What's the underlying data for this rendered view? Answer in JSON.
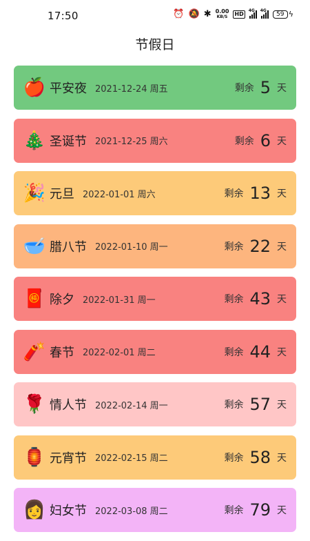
{
  "status_bar": {
    "time": "17:50",
    "net_speed_value": "0.00",
    "net_speed_unit": "KB/S",
    "hd_label": "HD",
    "signal1_label": "4G",
    "signal2_label": "4G",
    "battery": "59"
  },
  "header": {
    "title": "节假日"
  },
  "holidays": [
    {
      "emoji": "🍎",
      "name": "平安夜",
      "date": "2021-12-24 周五",
      "remain_label": "剩余",
      "days": "5",
      "unit": "天",
      "color": "#72c97f"
    },
    {
      "emoji": "🎄",
      "name": "圣诞节",
      "date": "2021-12-25 周六",
      "remain_label": "剩余",
      "days": "6",
      "unit": "天",
      "color": "#f98280"
    },
    {
      "emoji": "🎉",
      "name": "元旦",
      "date": "2022-01-01 周六",
      "remain_label": "剩余",
      "days": "13",
      "unit": "天",
      "color": "#fdca79"
    },
    {
      "emoji": "🥣",
      "name": "腊八节",
      "date": "2022-01-10 周一",
      "remain_label": "剩余",
      "days": "22",
      "unit": "天",
      "color": "#fdb57e"
    },
    {
      "emoji": "🧧",
      "name": "除夕",
      "date": "2022-01-31 周一",
      "remain_label": "剩余",
      "days": "43",
      "unit": "天",
      "color": "#f98280"
    },
    {
      "emoji": "🧨",
      "name": "春节",
      "date": "2022-02-01 周二",
      "remain_label": "剩余",
      "days": "44",
      "unit": "天",
      "color": "#f98280"
    },
    {
      "emoji": "🌹",
      "name": "情人节",
      "date": "2022-02-14 周一",
      "remain_label": "剩余",
      "days": "57",
      "unit": "天",
      "color": "#ffc6c6"
    },
    {
      "emoji": "🏮",
      "name": "元宵节",
      "date": "2022-02-15 周二",
      "remain_label": "剩余",
      "days": "58",
      "unit": "天",
      "color": "#fdca79"
    },
    {
      "emoji": "👩",
      "name": "妇女节",
      "date": "2022-03-08 周二",
      "remain_label": "剩余",
      "days": "79",
      "unit": "天",
      "color": "#f3b4f7"
    }
  ]
}
